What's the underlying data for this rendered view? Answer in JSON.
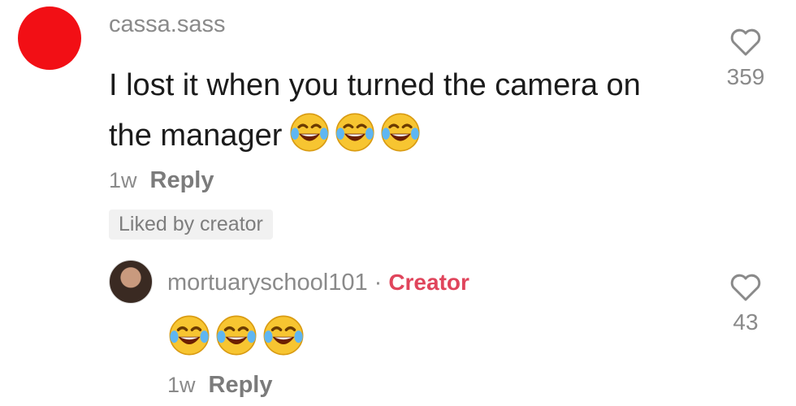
{
  "comment": {
    "username": "cassa.sass",
    "text": "I lost it when you turned the camera on the manager",
    "emoji": "face-with-tears-of-joy",
    "emoji_count": 3,
    "time": "1w",
    "reply_label": "Reply",
    "liked_badge": "Liked by creator",
    "like_count": "359",
    "avatar_color": "#f20f15"
  },
  "reply": {
    "username": "mortuaryschool101",
    "separator": "·",
    "creator_label": "Creator",
    "creator_color": "#e0455c",
    "emoji": "face-with-tears-of-joy",
    "emoji_count": 3,
    "time": "1w",
    "reply_label": "Reply",
    "like_count": "43"
  }
}
